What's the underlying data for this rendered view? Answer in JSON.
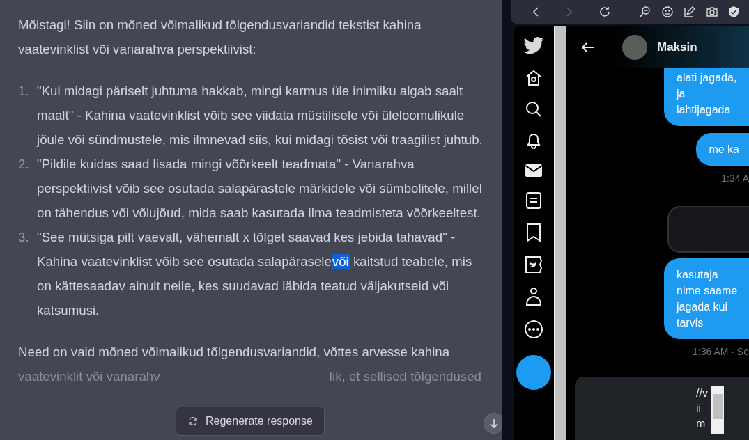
{
  "chat": {
    "intro": "Mõistagi! Siin on mõned võimalikud tõlgendusvariandid tekstist kahina vaatevinklist või vanarahva perspektiivist:",
    "list": [
      {
        "number": "1.",
        "text_before": "\"Kui midagi päriselt juhtuma hakkab, mingi karmus üle inimliku algab saalt maalt\" - Kahina vaatevinklist võib see viidata müstilisele või üleloomulikule jõule või sündmustele, mis ilmnevad siis, kui midagi tõsist või traagilist juhtub."
      },
      {
        "number": "2.",
        "text_before": "\"Pildile kuidas saad lisada mingi võõrkeelt teadmata\" - Vanarahva perspektiivist võib see osutada salapärastele märkidele või sümbolitele, millel on tähendus või võlujõud, mida saab kasutada ilma teadmisteta võõrkeeltest."
      },
      {
        "number": "3.",
        "text_before": "\"See mütsiga pilt vaevalt, vähemalt x tõlget saavad kes jebida tahavad\" - Kahina vaatevinklist võib see osutada salapärasele",
        "selected_text": "või",
        "text_after": "kaitstud teabele, mis on kättesaadav ainult neile, kes suudavad läbida teatud väljakutseid või katsumusi."
      }
    ],
    "outro_line": "Need on vaid mõned võimalikud tõlgendusvariandid, võttes arvesse kahina",
    "outro_left": "vaatevinklit või vanarahv",
    "outro_right": "lik, et sellised tõlgendused",
    "regenerate_button": "Regenerate response"
  },
  "browser": {
    "toolbar": [
      {
        "kind": "back",
        "disabled": false
      },
      {
        "kind": "forward",
        "disabled": true
      },
      {
        "kind": "reload",
        "disabled": false
      },
      {
        "kind": "zoom",
        "disabled": false
      },
      {
        "kind": "emoji",
        "disabled": false
      },
      {
        "kind": "pen",
        "disabled": false
      },
      {
        "kind": "camera",
        "disabled": false
      },
      {
        "kind": "shield",
        "disabled": false
      }
    ]
  },
  "twitter": {
    "nav": [
      {
        "kind": "bird"
      },
      {
        "kind": "home"
      },
      {
        "kind": "search"
      },
      {
        "kind": "bell"
      },
      {
        "kind": "mail"
      },
      {
        "kind": "list"
      },
      {
        "kind": "bookmark"
      },
      {
        "kind": "blue"
      },
      {
        "kind": "person"
      },
      {
        "kind": "more"
      }
    ],
    "contact_name": "Maksin",
    "messages": [
      {
        "kind": "bubble",
        "text": "alati jagada, ja lahtijagada"
      },
      {
        "kind": "bubble",
        "text": "me ka"
      },
      {
        "kind": "time",
        "text": "1:34 A"
      },
      {
        "kind": "image"
      },
      {
        "kind": "bubble",
        "text": "kasutaja nime saame jagada kui tarvis"
      },
      {
        "kind": "time",
        "text": "1:36 AM · Se"
      }
    ],
    "composer_text": "//v ii m"
  }
}
